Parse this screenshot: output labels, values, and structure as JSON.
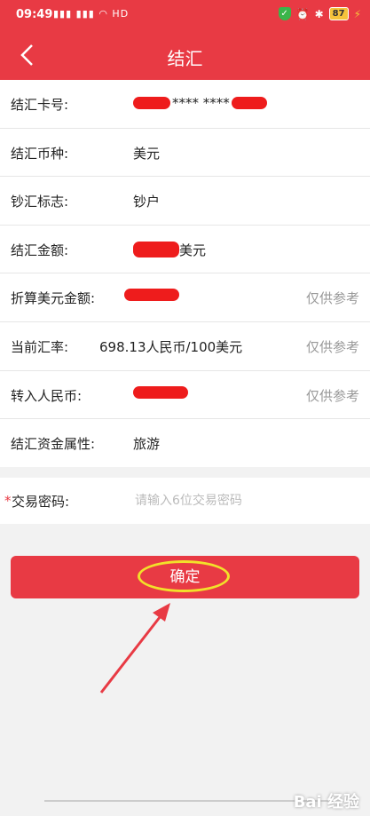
{
  "status_bar": {
    "time": "09:49",
    "signal_text": "HD",
    "battery": "87"
  },
  "header": {
    "title": "结汇"
  },
  "rows": [
    {
      "label": "结汇卡号:",
      "value": "**** ****",
      "note": ""
    },
    {
      "label": "结汇币种:",
      "value": "美元",
      "note": ""
    },
    {
      "label": "钞汇标志:",
      "value": "钞户",
      "note": ""
    },
    {
      "label": "结汇金额:",
      "value": "美元",
      "note": ""
    },
    {
      "label": "折算美元金额:",
      "value": "",
      "note": "仅供参考"
    },
    {
      "label": "当前汇率:",
      "value": "698.13人民币/100美元",
      "note": "仅供参考"
    },
    {
      "label": "转入人民币:",
      "value": "",
      "note": "仅供参考"
    },
    {
      "label": "结汇资金属性:",
      "value": "旅游",
      "note": ""
    }
  ],
  "password": {
    "required_mark": "*",
    "label": "交易密码:",
    "placeholder": "请输入6位交易密码"
  },
  "confirm_button": {
    "label": "确定"
  },
  "watermark": "Bai 经验",
  "colors": {
    "brand_red": "#e83a44",
    "annotation_yellow": "#f2e02a",
    "redaction_red": "#ee1c1c"
  }
}
